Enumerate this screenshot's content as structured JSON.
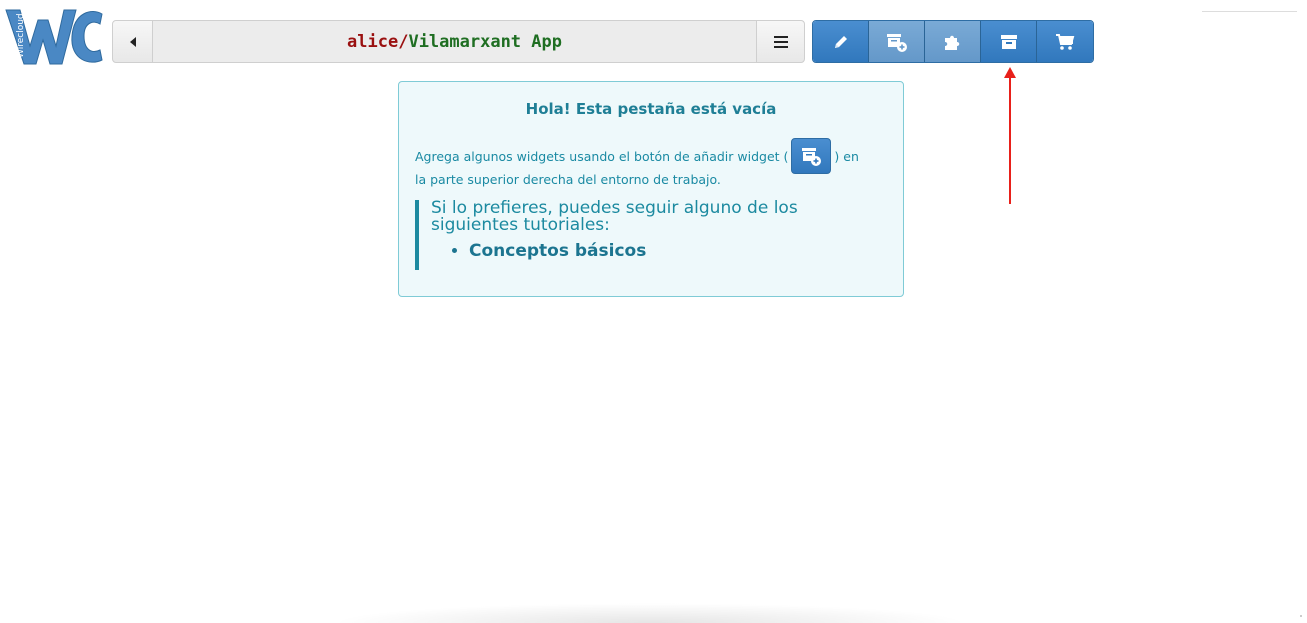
{
  "logo": {
    "icon": "wirecloud-logo",
    "text": "Wirecloud",
    "color": "#4a88c4"
  },
  "pathbar": {
    "owner": "alice",
    "separator": "/",
    "workspace": "Vilamarxant App",
    "back_icon": "caret-left-icon",
    "menu_icon": "hamburger-icon"
  },
  "toolbar": {
    "buttons": [
      {
        "icon": "pencil-icon",
        "label": "Edit"
      },
      {
        "icon": "add-widget-icon",
        "label": "Add widget"
      },
      {
        "icon": "puzzle-icon",
        "label": "Wiring"
      },
      {
        "icon": "archive-icon",
        "label": "My resources"
      },
      {
        "icon": "shopping-cart-icon",
        "label": "Marketplace"
      }
    ],
    "colors": {
      "primary": "#3178bd",
      "muted": "#6498c9"
    }
  },
  "panel": {
    "title": "Hola! Esta pestaña está vacía",
    "line1_before": "Agrega algunos widgets usando el botón de añadir widget (",
    "line1_after": ") en",
    "line2": "la parte superior derecha del entorno de trabajo.",
    "quote": "Si lo prefieres, puedes seguir alguno de los siguientes tutoriales:",
    "tutorials": [
      "Conceptos básicos"
    ]
  },
  "annotation": {
    "arrow_color": "#e8201a"
  }
}
